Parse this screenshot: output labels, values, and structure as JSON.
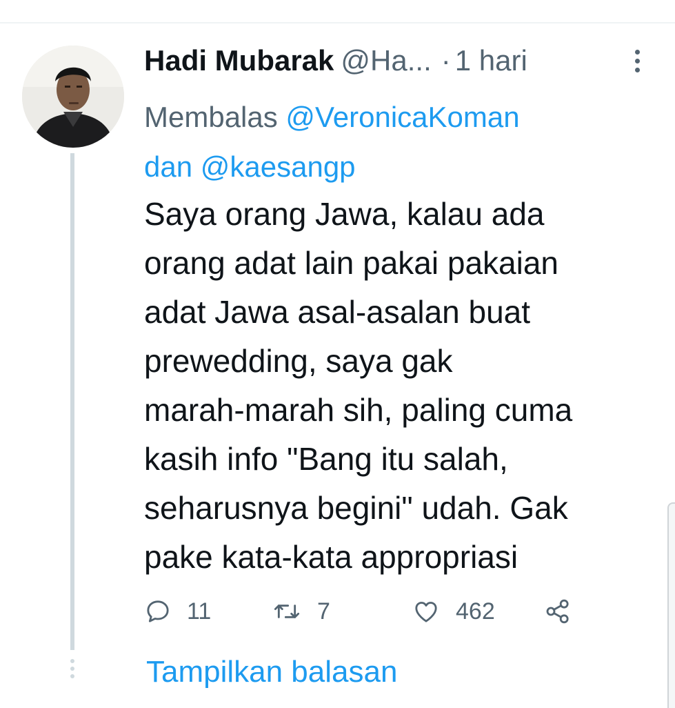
{
  "tweet": {
    "author_name": "Hadi Mubarak",
    "handle": "@Ha...",
    "separator": "·",
    "time": "1 hari",
    "reply_prefix": "Membalas",
    "reply_mention_1": "@VeronicaKoman",
    "reply_joiner": "dan",
    "reply_mention_2": "@kaesangp",
    "text": "Saya orang Jawa, kalau ada\norang adat lain pakai pakaian\nadat Jawa asal-asalan buat\nprewedding, saya gak\nmarah-marah sih, paling cuma\nkasih info \"Bang itu salah,\nseharusnya begini\" udah. Gak\npake kata-kata appropriasi"
  },
  "actions": {
    "reply_count": "11",
    "retweet_count": "7",
    "like_count": "462"
  },
  "icons": {
    "reply": "reply-icon",
    "retweet": "retweet-icon",
    "like": "heart-icon",
    "share": "share-icon",
    "more": "more-vertical-icon"
  },
  "show_replies_label": "Tampilkan balasan",
  "colors": {
    "text": "#0f1419",
    "secondary": "#536471",
    "accent": "#1d9bf0",
    "thread_line": "#cfd9de"
  }
}
